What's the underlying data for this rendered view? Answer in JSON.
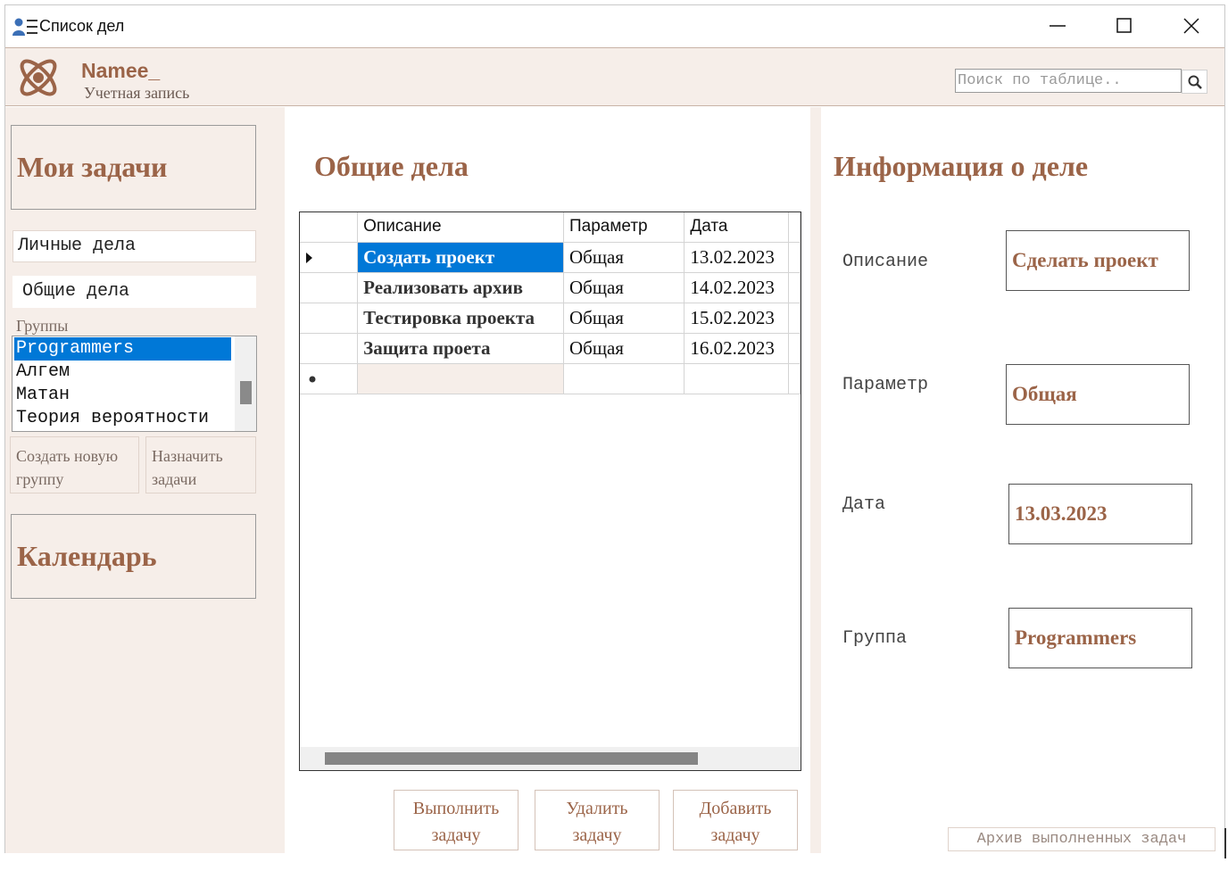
{
  "window": {
    "title": "Список дел"
  },
  "header": {
    "user_name": "Namee_",
    "user_subtitle": "Учетная запись",
    "search_placeholder": "Поиск по таблице.."
  },
  "sidebar": {
    "my_tasks": "Мои задачи",
    "personal": "Личные дела",
    "common": "Общие дела",
    "groups_label": "Группы",
    "groups": [
      "Programmers",
      "Алгем",
      "Матан",
      "Теория вероятности"
    ],
    "selected_group": "Programmers",
    "create_group": [
      "Создать новую",
      "группу"
    ],
    "assign_tasks": [
      "Назначить",
      "задачи"
    ],
    "calendar": "Календарь"
  },
  "center": {
    "title": "Общие дела",
    "columns": [
      "Описание",
      "Параметр",
      "Дата"
    ],
    "rows": [
      {
        "description": "Создать проект",
        "parameter": "Общая",
        "date": "13.02.2023"
      },
      {
        "description": "Реализовать архив",
        "parameter": "Общая",
        "date": "14.02.2023"
      },
      {
        "description": "Тестировка проекта",
        "parameter": "Общая",
        "date": "15.02.2023"
      },
      {
        "description": "Защита проета",
        "parameter": "Общая",
        "date": "16.02.2023"
      }
    ],
    "selected_row": 0,
    "buttons": {
      "complete": [
        "Выполнить",
        "задачу"
      ],
      "delete": [
        "Удалить",
        "задачу"
      ],
      "add": [
        "Добавить",
        "задачу"
      ]
    }
  },
  "info": {
    "title": "Информация о деле",
    "description_label": "Описание",
    "description_value": "Сделать проект",
    "parameter_label": "Параметр",
    "parameter_value": "Общая",
    "date_label": "Дата",
    "date_value": "13.03.2023",
    "group_label": "Группа",
    "group_value": "Programmers",
    "archive_button": "Архив выполненных задач"
  },
  "colors": {
    "accent": "#9b6448",
    "panel_bg": "#f6eee9",
    "selection": "#0078d7"
  },
  "icons": {
    "app": "user-list-icon",
    "logo": "atom-logo-icon",
    "search": "search-icon"
  }
}
